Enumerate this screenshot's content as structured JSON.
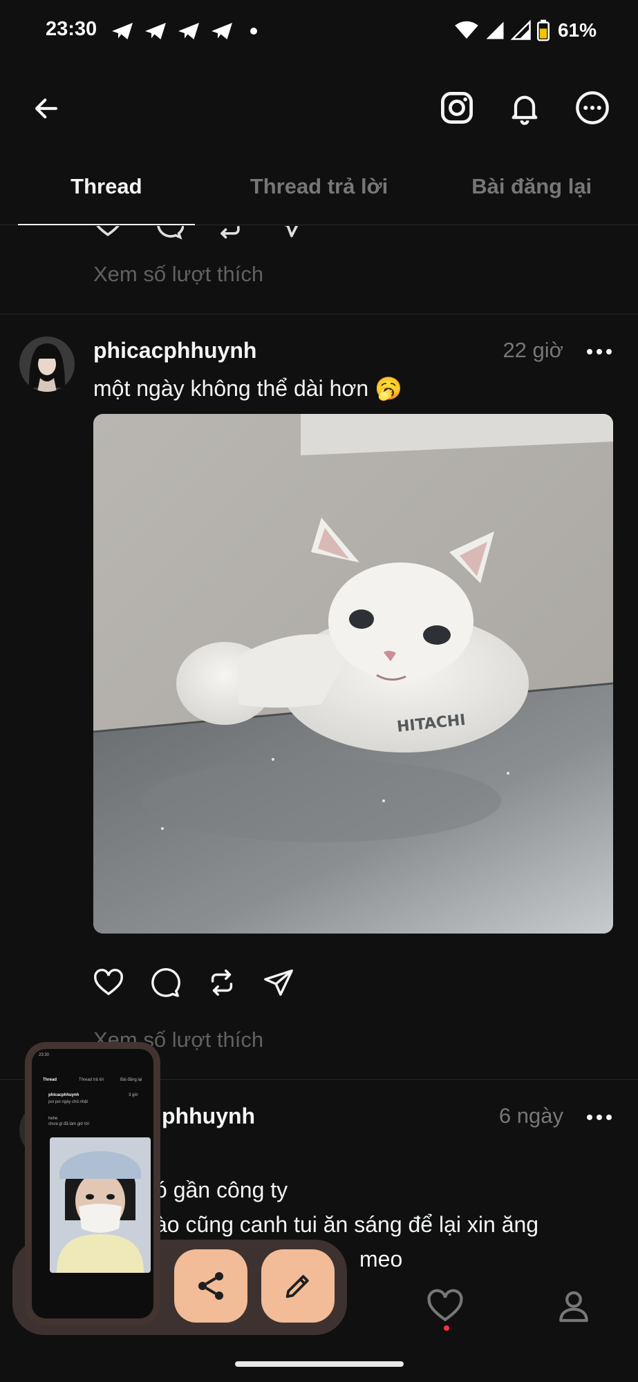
{
  "status_bar": {
    "time": "23:30",
    "battery": "61%"
  },
  "top_bar": {
    "icons": [
      "back-arrow-icon",
      "instagram-icon",
      "bell-icon",
      "more-horizontal-icon"
    ]
  },
  "tabs": [
    {
      "label": "Thread",
      "active": true
    },
    {
      "label": "Thread trả lời",
      "active": false
    },
    {
      "label": "Bài đăng lại",
      "active": false
    }
  ],
  "feed": {
    "prev_post": {
      "likes_link": "Xem số lượt thích"
    },
    "post_1": {
      "username": "phicacphhuynh",
      "time": "22 giờ",
      "text": "một ngày không thể dài hơn 🥱",
      "image_alt": "white cat resting on top of a gray refrigerator",
      "likes_link": "Xem số lượt thích"
    },
    "post_2": {
      "username": "phhuynh",
      "time": "6 ngày",
      "line_1": "ó gần công ty",
      "line_2": "ào cũng canh tui ăn sáng để lại xin ăng",
      "line_3": "meo"
    }
  },
  "screenshot_preview": {
    "time": "23:30",
    "tabs": [
      "Thread",
      "Thread trả lời",
      "Bài đăng lại"
    ],
    "username": "phicacphhuynh",
    "time_ago": "3 giờ",
    "line_1": "poi poi ngày chủ nhật",
    "line_2": "hehe",
    "line_3": "chưa gì đã làm giờ tới"
  },
  "colors": {
    "background": "#101010",
    "text_primary": "#f3f5f7",
    "text_secondary": "#777777",
    "fab": "#f1bc97",
    "overlay": "#3d3230",
    "notification_dot": "#ff3040"
  }
}
